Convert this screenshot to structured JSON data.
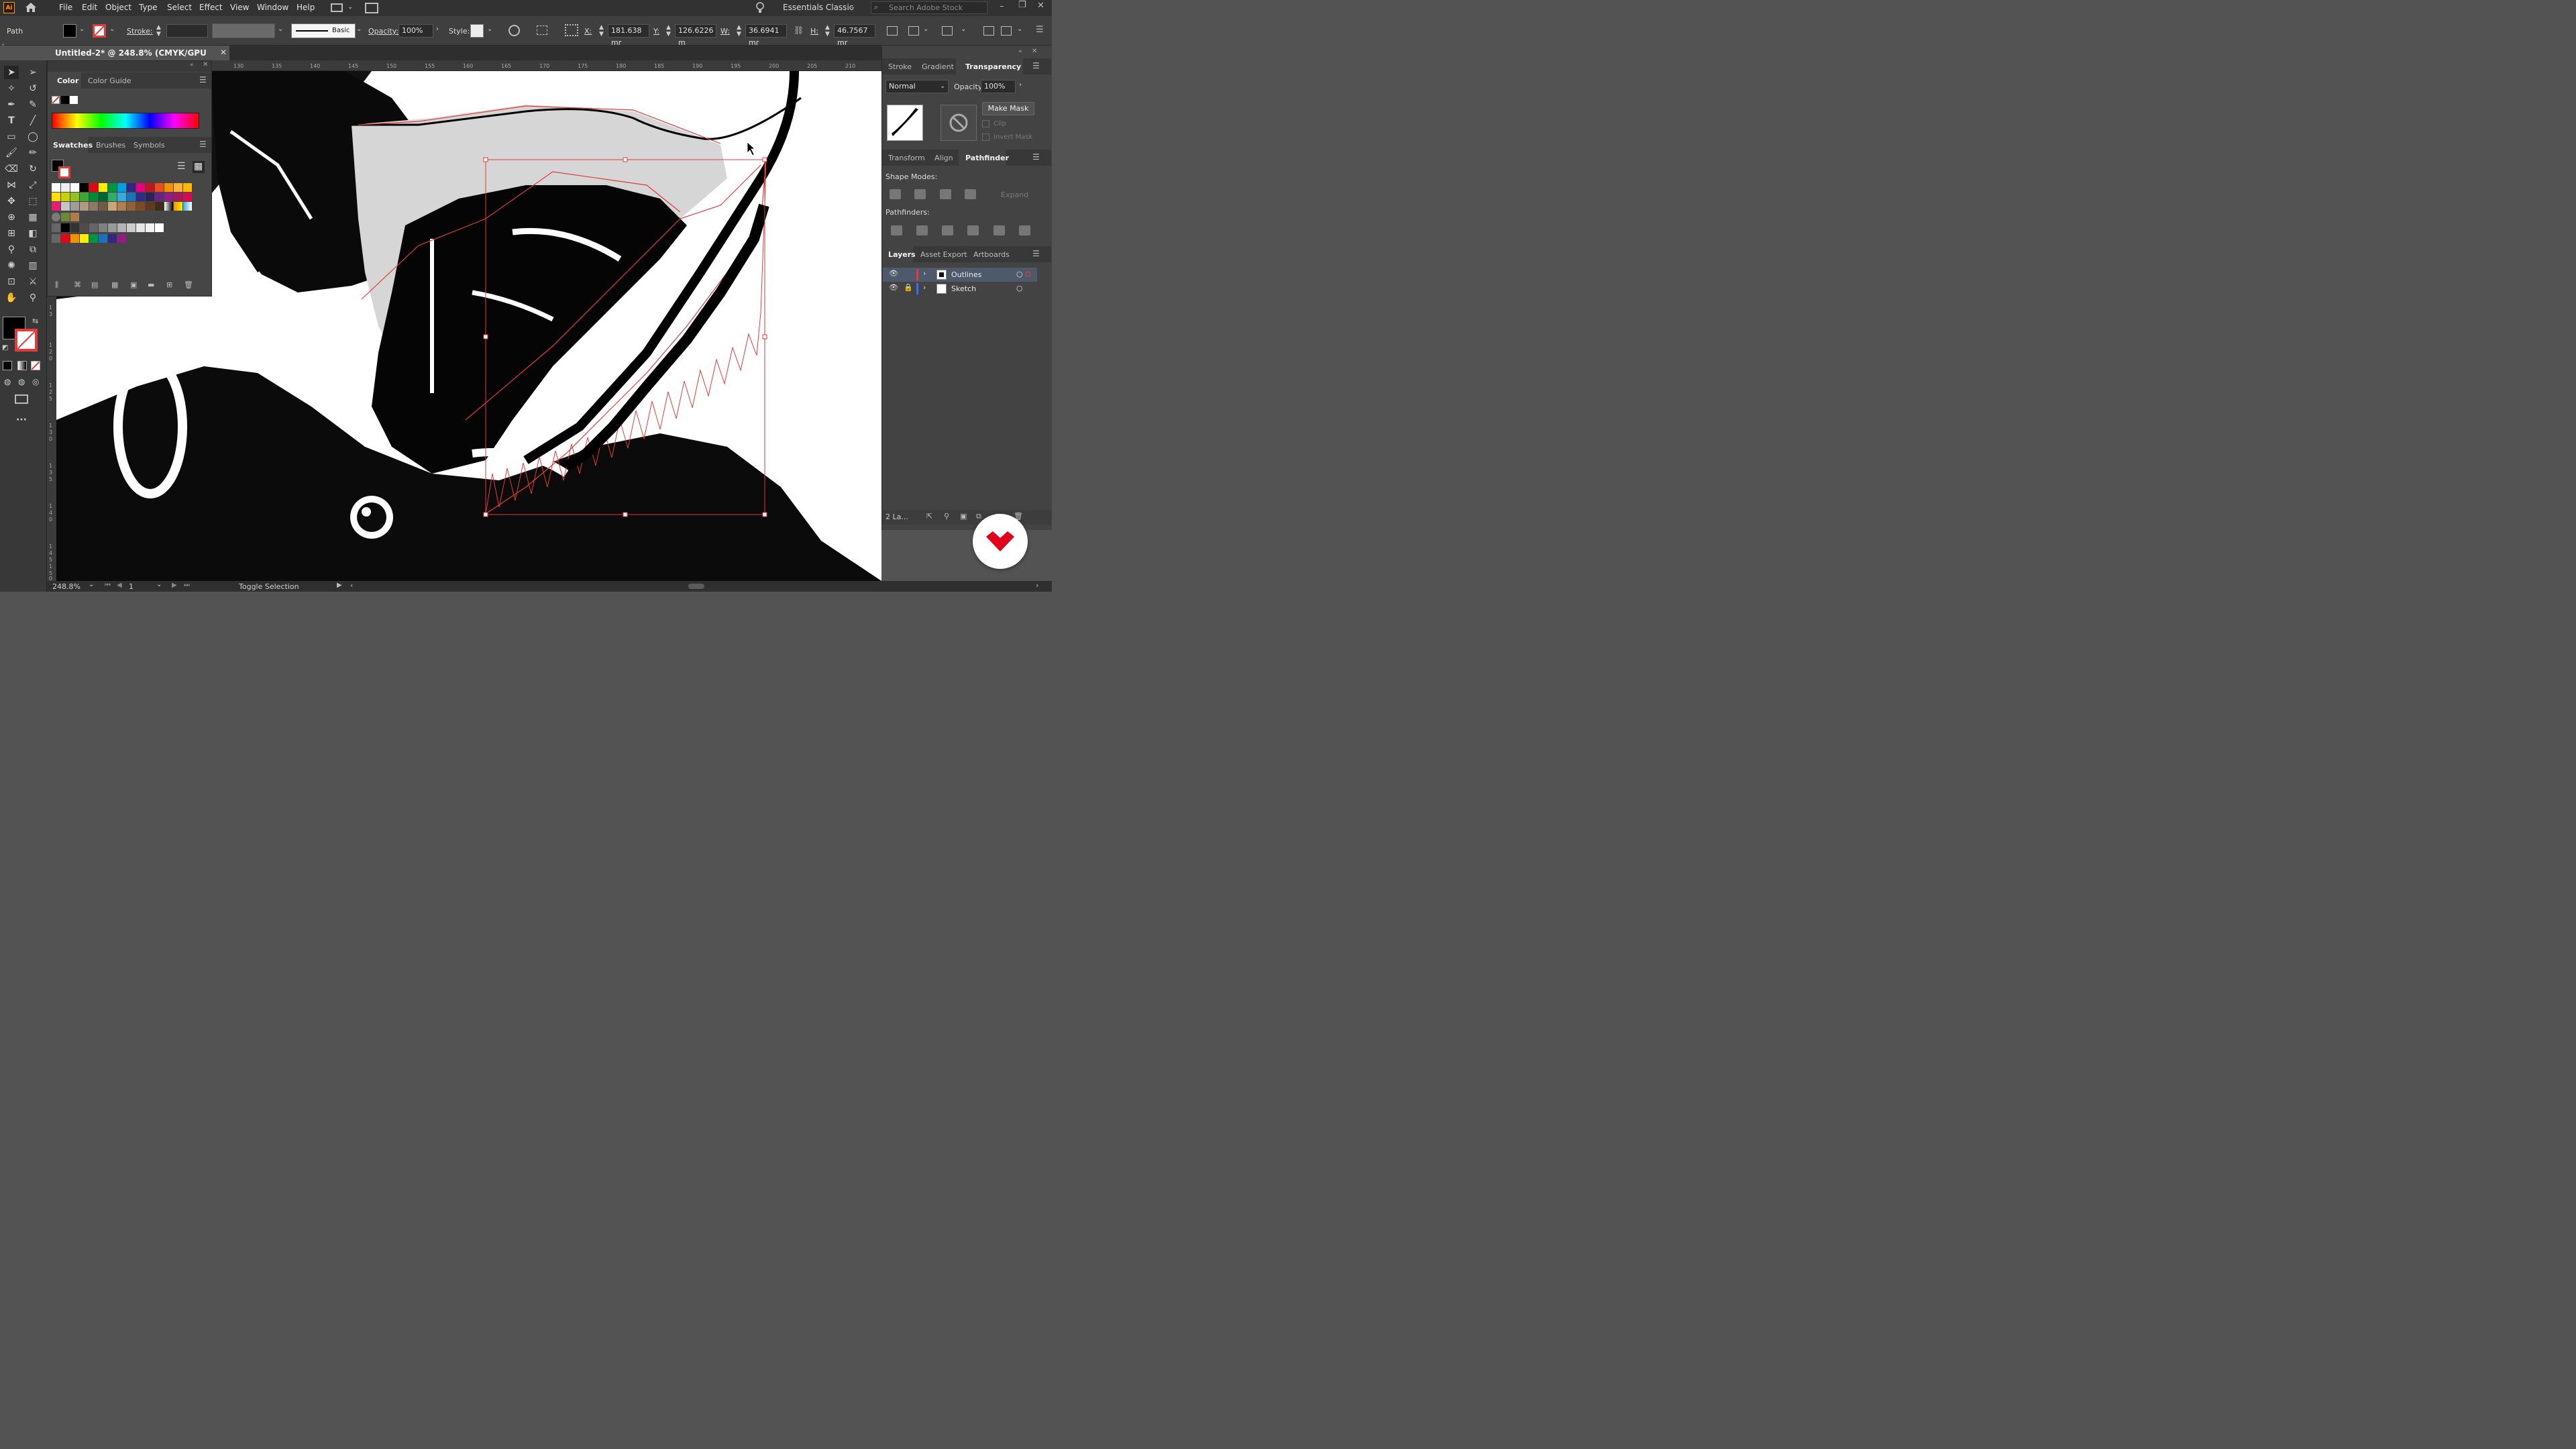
{
  "app": {
    "logo_text": "Ai"
  },
  "menu": {
    "items": [
      "File",
      "Edit",
      "Object",
      "Type",
      "Select",
      "Effect",
      "View",
      "Window",
      "Help"
    ]
  },
  "workspace": {
    "label": "Essentials Classic",
    "search_placeholder": "Search Adobe Stock"
  },
  "control": {
    "selection_type": "Path",
    "stroke_label": "Stroke:",
    "brush_label": "Basic",
    "opacity_label": "Opacity:",
    "opacity_value": "100%",
    "style_label": "Style:",
    "x_label": "X:",
    "x_value": "181.638 mr",
    "y_label": "Y:",
    "y_value": "126.6226 m",
    "w_label": "W:",
    "w_value": "36.6941 mr",
    "h_label": "H:",
    "h_value": "46.7567 mr"
  },
  "document": {
    "tab_title": "Untitled-2* @ 248.8% (CMYK/GPU Preview)"
  },
  "ruler": {
    "ticks": [
      "130",
      "135",
      "140",
      "145",
      "150",
      "155",
      "160",
      "165",
      "170",
      "175",
      "180",
      "185",
      "190",
      "195",
      "200",
      "205",
      "210"
    ],
    "v_ticks": [
      "1",
      "3",
      "1",
      "2",
      "0",
      "1",
      "2",
      "5",
      "1",
      "3",
      "0",
      "1",
      "3",
      "5",
      "1",
      "4",
      "0",
      "1",
      "4",
      "5",
      "1",
      "5",
      "0"
    ]
  },
  "color_panel": {
    "tabs": [
      "Color",
      "Color Guide"
    ]
  },
  "swatches_panel": {
    "tabs": [
      "Swatches",
      "Brushes",
      "Symbols"
    ]
  },
  "right_panels": {
    "group1_tabs": [
      "Stroke",
      "Gradient",
      "Transparency"
    ],
    "blend_mode": "Normal",
    "opacity_label": "Opacity:",
    "opacity_value": "100%",
    "make_mask": "Make Mask",
    "clip": "Clip",
    "invert_mask": "Invert Mask",
    "group2_tabs": [
      "Transform",
      "Align",
      "Pathfinder"
    ],
    "shape_modes": "Shape Modes:",
    "expand": "Expand",
    "pathfinders": "Pathfinders:",
    "group3_tabs": [
      "Layers",
      "Asset Export",
      "Artboards"
    ],
    "layers": [
      {
        "name": "Outlines",
        "color": "#e23b3b",
        "locked": false
      },
      {
        "name": "Sketch",
        "color": "#3d6bff",
        "locked": true
      }
    ],
    "layers_count": "2 La..."
  },
  "status": {
    "zoom": "248.8%",
    "artboard": "1",
    "tool_hint": "Toggle Selection"
  },
  "colors": {
    "selection": "#e23b3b",
    "accent": "#e0001b"
  }
}
